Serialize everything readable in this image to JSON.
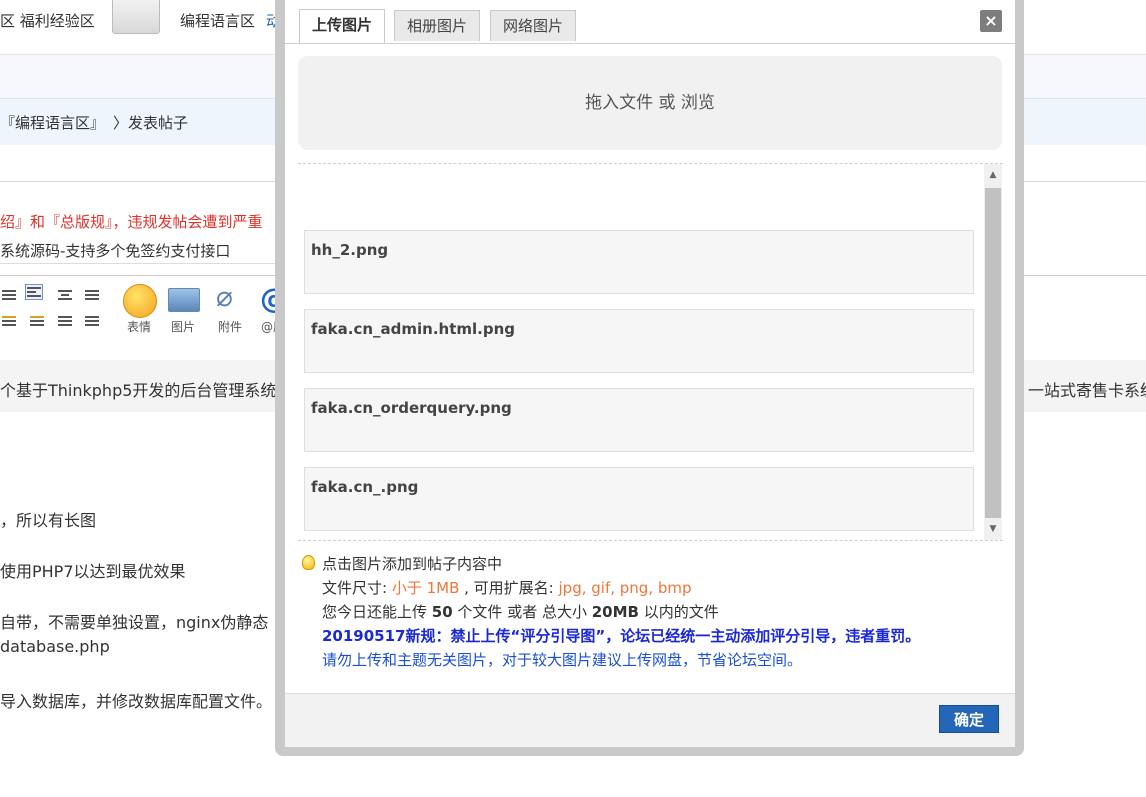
{
  "background": {
    "forum_link_1": "区 福利经验区",
    "forum_link_2": "编程语言区",
    "forum_link_2_suffix": "动",
    "breadcrumb": [
      "『编程语言区』",
      "〉发表帖子"
    ],
    "notice_prefix": "绍』和『总版规』",
    "notice_warning": "，违规发帖会遭到严重",
    "subject": "系统源码-支持多个免签约支付接口",
    "toolbar": {
      "emoji": "表情",
      "image": "图片",
      "attachment": "附件",
      "mention": "@朋"
    },
    "content_lines": [
      "个基于Thinkphp5开发的后台管理系统",
      "一站式寄售卡系统",
      "，所以有长图",
      "使用PHP7以达到最优效果",
      "自带，不需要单独设置，nginx伪静态",
      "database.php",
      "导入数据库，并修改数据库配置文件。"
    ]
  },
  "dialog": {
    "tabs": [
      {
        "label": "上传图片",
        "active": true
      },
      {
        "label": "相册图片",
        "active": false
      },
      {
        "label": "网络图片",
        "active": false
      }
    ],
    "close_label": "×",
    "dropzone_text": "拖入文件 或 浏览",
    "files": [
      "hh_2.png",
      "faka.cn_admin.html.png",
      "faka.cn_orderquery.png",
      "faka.cn_.png"
    ],
    "info": {
      "hint": "点击图片添加到帖子内容中",
      "size_prefix": "文件尺寸: ",
      "size_value": "小于 1MB",
      "ext_prefix": " , 可用扩展名: ",
      "ext_value": "jpg, gif, png, bmp",
      "quota_a": "您今日还能上传 ",
      "quota_count": "50",
      "quota_b": " 个文件 或者 总大小 ",
      "quota_size": "20MB",
      "quota_c": " 以内的文件",
      "rule": "20190517新规：禁止上传“评分引导图”，论坛已经统一主动添加评分引导，违者重罚。",
      "advice": "请勿上传和主题无关图片，对于较大图片建议上传网盘，节省论坛空间。"
    },
    "ok_label": "确定"
  }
}
